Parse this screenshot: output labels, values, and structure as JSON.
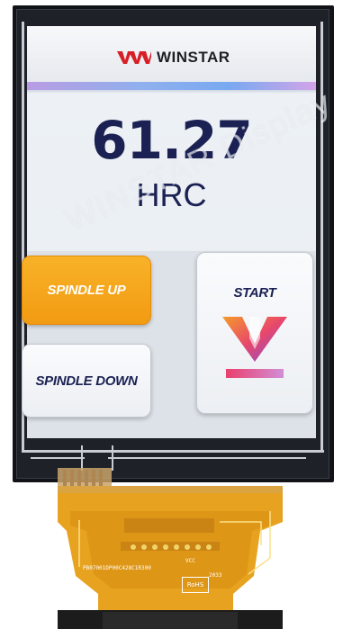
{
  "brand": {
    "name": "WINSTAR",
    "watermark": "WINSTAR Display"
  },
  "measurement": {
    "value": "61.27",
    "unit": "HRC"
  },
  "buttons": {
    "spindle_up": "SPINDLE UP",
    "spindle_down": "SPINDLE DOWN",
    "start": "START"
  },
  "flex_print": {
    "line1": "PB07001DP00C428C1R300",
    "line2": "VCC",
    "line3": "RoHS",
    "date": "2033"
  },
  "colors": {
    "accent_orange": "#f29b12",
    "text_navy": "#1b2153",
    "brand_red": "#d71f26"
  },
  "icons": {
    "logo": "winstar-wave-logo",
    "start": "download-arrow-icon"
  }
}
